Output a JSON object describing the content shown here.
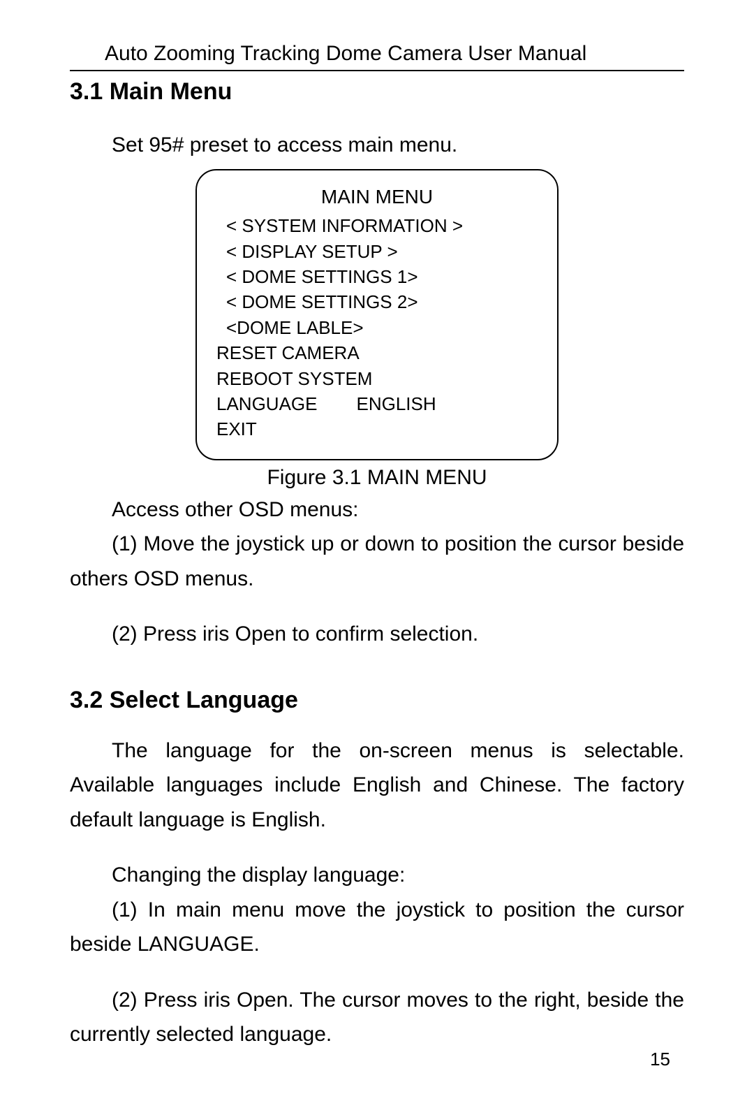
{
  "header": "Auto Zooming Tracking Dome Camera User Manual",
  "section31": {
    "title": "3.1 Main Menu",
    "intro": "Set 95# preset to access main menu.",
    "menu": {
      "title": "MAIN MENU",
      "lines": [
        "< SYSTEM INFORMATION >",
        "< DISPLAY SETUP >",
        "< DOME SETTINGS 1>",
        "< DOME SETTINGS 2>",
        "<DOME LABLE>",
        "RESET CAMERA",
        "REBOOT SYSTEM"
      ],
      "language_key": "LANGUAGE",
      "language_value": "ENGLISH",
      "exit": "EXIT"
    },
    "caption": "Figure 3.1 MAIN MENU",
    "access_label": "Access other OSD menus:",
    "step1": "(1) Move the joystick up or down to position the cursor beside others OSD menus.",
    "step2": "(2) Press iris Open to confirm selection."
  },
  "section32": {
    "title": "3.2 Select Language",
    "intro": "The language for the on-screen menus is selectable. Available languages include English and Chinese. The factory default language is English.",
    "change_label": "Changing the display language:",
    "step1": "(1) In main menu move the joystick to position the cursor beside LANGUAGE.",
    "step2": "(2) Press iris Open. The cursor moves to the right, beside the currently selected language."
  },
  "page_number": "15"
}
